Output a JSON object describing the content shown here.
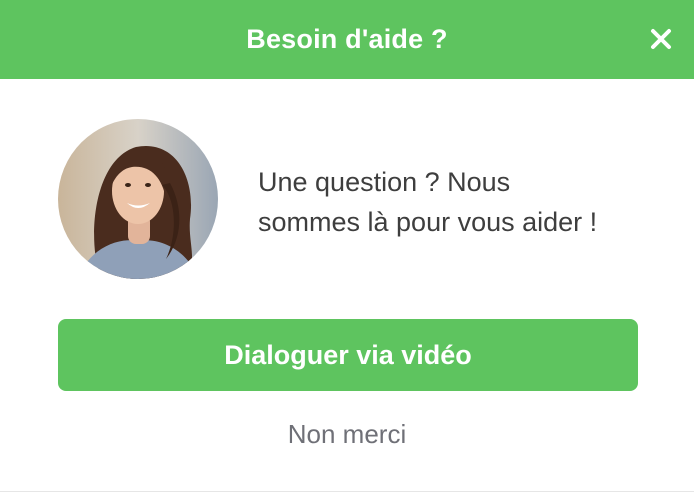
{
  "header": {
    "title": "Besoin d'aide ?",
    "close_icon": "close-icon"
  },
  "agent": {
    "avatar_icon": "agent-avatar-photo"
  },
  "message": {
    "line1": "Une question ? Nous",
    "line2": "sommes là pour vous aider !"
  },
  "actions": {
    "primary_label": "Dialoguer via vidéo",
    "secondary_label": "Non merci"
  },
  "colors": {
    "accent": "#5ec45f",
    "text": "#3e3e3e",
    "muted": "#6f7077",
    "background": "#ffffff"
  }
}
